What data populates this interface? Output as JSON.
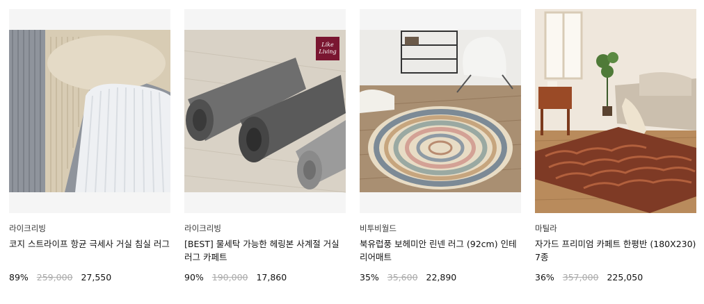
{
  "products": [
    {
      "brand": "라이크리빙",
      "title": "코지 스트라이프 항균 극세사 거실 침실 러그",
      "discount": "89%",
      "original_price": "259,000",
      "price": "27,550",
      "image": "striped-fleece-rug-image"
    },
    {
      "brand": "라이크리빙",
      "title": "[BEST] 물세탁 가능한 헤링본 사계절 거실 러그 카페트",
      "discount": "90%",
      "original_price": "190,000",
      "price": "17,860",
      "image": "herringbone-rolled-rugs-image",
      "badge": "Like Living"
    },
    {
      "brand": "비투비월드",
      "title": "북유럽풍 보헤미안 린넨 러그 (92cm) 인테리어매트",
      "discount": "35%",
      "original_price": "35,600",
      "price": "22,890",
      "image": "bohemian-round-rug-image"
    },
    {
      "brand": "마틸라",
      "title": "자가드 프리미엄 카페트 한평반 (180X230) 7종",
      "discount": "36%",
      "original_price": "357,000",
      "price": "225,050",
      "image": "jacquard-carpet-livingroom-image"
    }
  ]
}
